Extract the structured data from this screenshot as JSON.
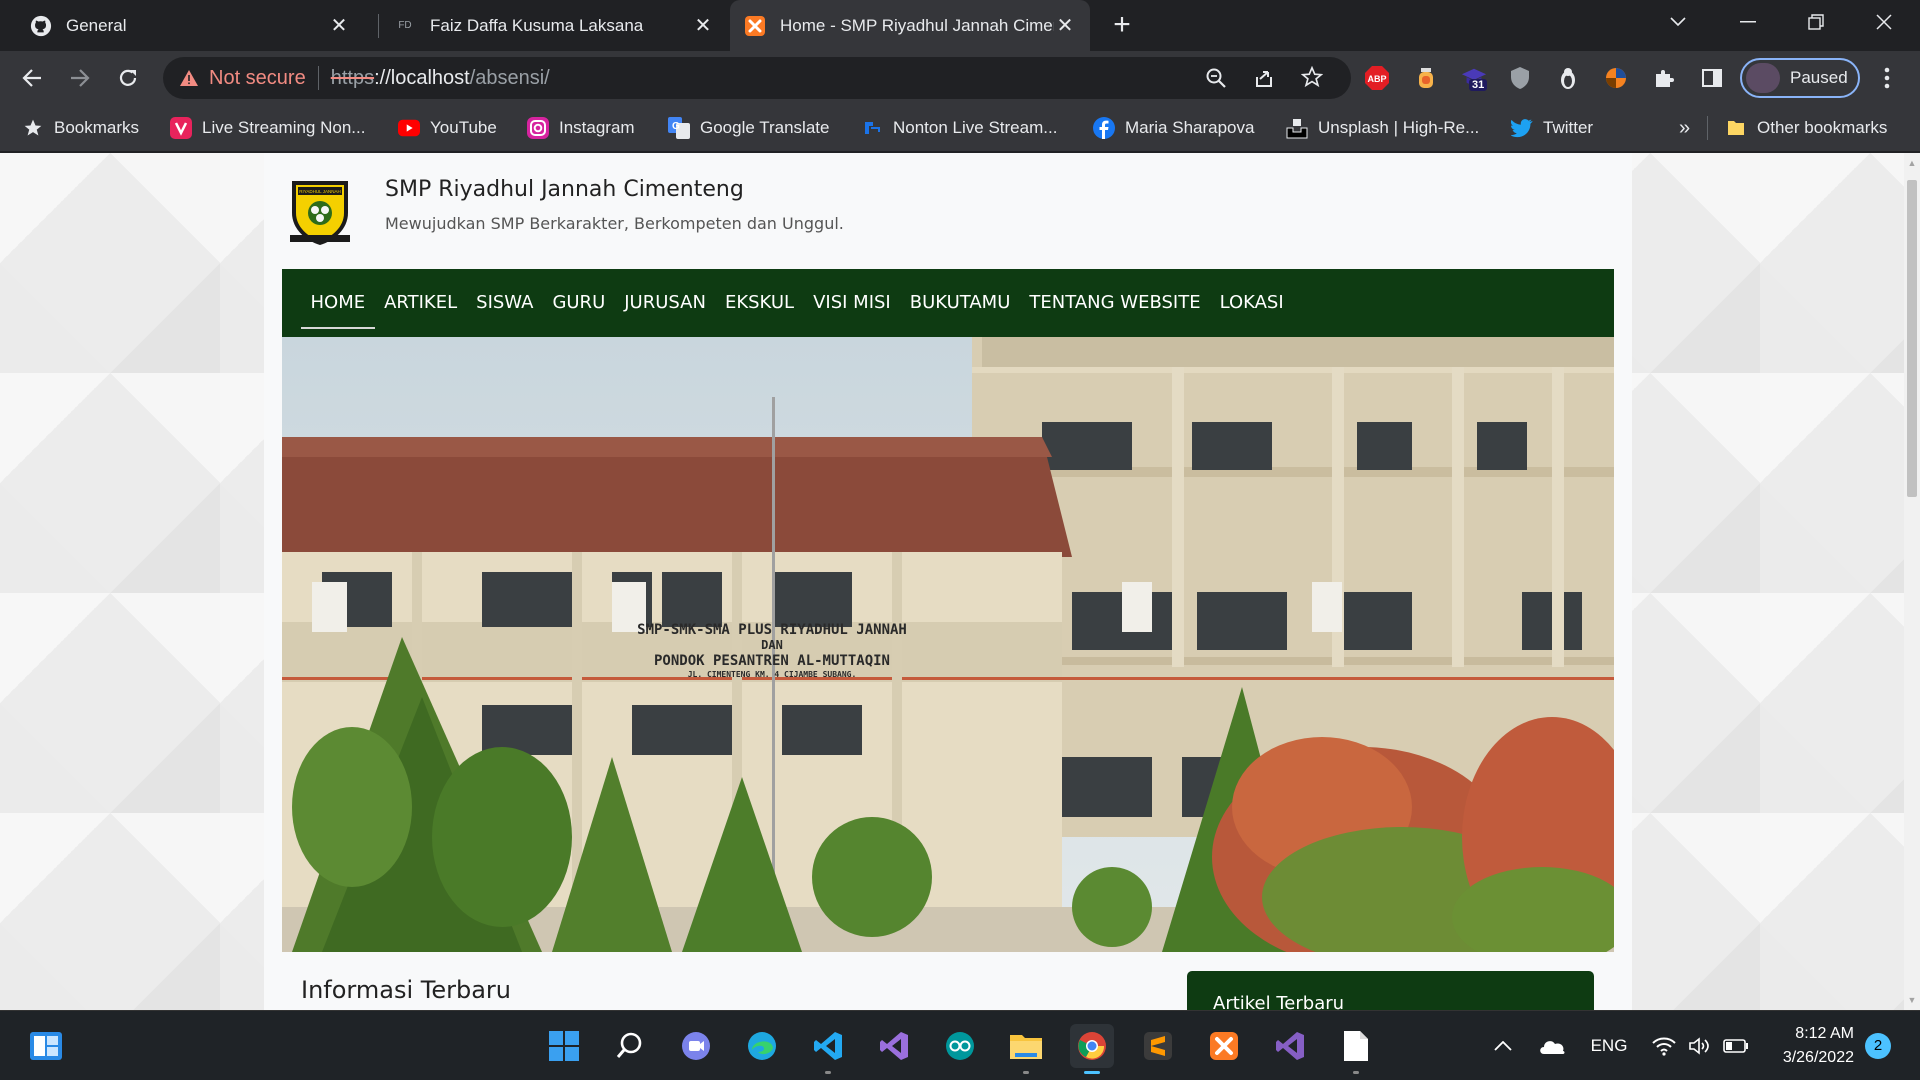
{
  "browser": {
    "tabs": [
      {
        "title": "General",
        "icon": "github-icon"
      },
      {
        "title": "Faiz Daffa Kusuma Laksana",
        "icon": "fd-icon"
      },
      {
        "title": "Home - SMP Riyadhul Jannah Cimenteng",
        "icon": "xampp-icon"
      }
    ],
    "security_label": "Not secure",
    "url": {
      "scheme": "https",
      "host": "://localhost",
      "path": "/absensi/"
    },
    "profile_label": "Paused",
    "extension_badge": "31"
  },
  "bookmarks": {
    "items": [
      {
        "label": "Bookmarks",
        "icon": "star-icon"
      },
      {
        "label": "Live Streaming Non...",
        "icon": "vidio-icon"
      },
      {
        "label": "YouTube",
        "icon": "youtube-icon"
      },
      {
        "label": "Instagram",
        "icon": "instagram-icon"
      },
      {
        "label": "Google Translate",
        "icon": "google-translate-icon"
      },
      {
        "label": "Nonton Live Stream...",
        "icon": "stream-icon"
      },
      {
        "label": "Maria Sharapova",
        "icon": "facebook-icon"
      },
      {
        "label": "Unsplash | High-Re...",
        "icon": "unsplash-icon"
      },
      {
        "label": "Twitter",
        "icon": "twitter-icon"
      }
    ],
    "overflow": "»",
    "other": "Other bookmarks"
  },
  "site": {
    "title": "SMP Riyadhul Jannah Cimenteng",
    "tagline": "Mewujudkan SMP Berkarakter, Berkompeten dan Unggul.",
    "logo_text": "RIYADHUL JANNAH",
    "nav": [
      "HOME",
      "ARTIKEL",
      "SISWA",
      "GURU",
      "JURUSAN",
      "EKSKUL",
      "VISI MISI",
      "BUKUTAMU",
      "TENTANG WEBSITE",
      "LOKASI"
    ],
    "hero_sign": [
      "SMP-SMK-SMA PLUS RIYADHUL JANNAH",
      "DAN",
      "PONDOK PESANTREN AL-MUTTAQIN",
      "JL. CIMENTENG KM. 4 CIJAMBE SUBANG."
    ],
    "info_title": "Informasi Terbaru",
    "sidebar_title": "Artikel Terbaru"
  },
  "taskbar": {
    "language": "ENG",
    "time": "8:12 AM",
    "date": "3/26/2022",
    "notifications": "2"
  },
  "colors": {
    "nav_green": "#0e3b12",
    "accent_blue": "#4cc2ff",
    "warning_red": "#f28b82"
  }
}
